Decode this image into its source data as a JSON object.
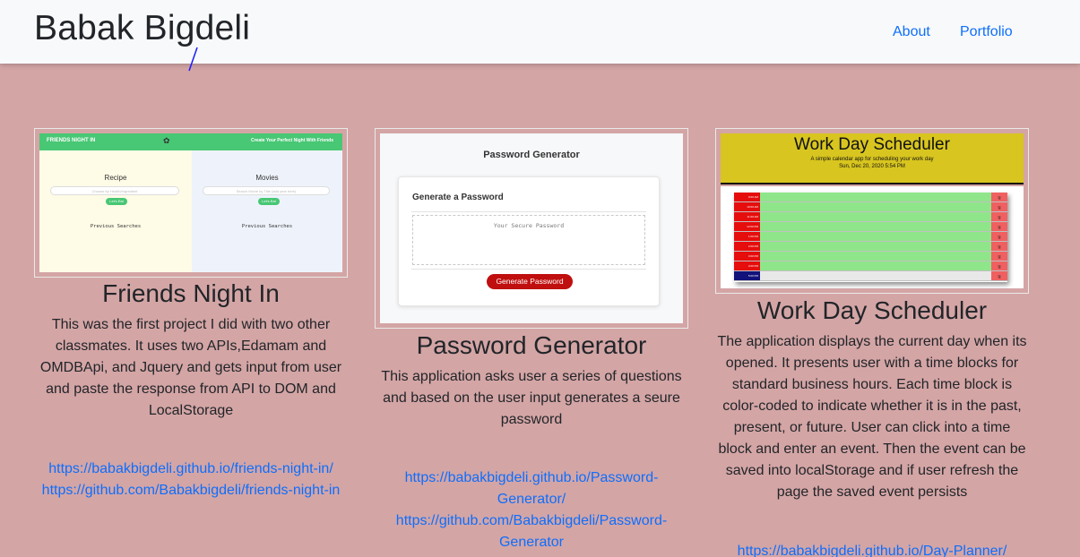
{
  "nav": {
    "brand": "Babak Bigdeli",
    "links": [
      "About",
      "Portfolio"
    ]
  },
  "projects": [
    {
      "title": "Friends Night In",
      "description": "This was the first project I did with two other classmates. It uses two APIs,Edamam and OMDBApi, and Jquery and gets input from user and paste the response from API to DOM and LocalStorage",
      "links": [
        "https://babakbigdeli.github.io/friends-night-in/",
        "https://github.com/Babakbigdeli/friends-night-in"
      ],
      "thumb": {
        "bar_left": "FRIENDS NIGHT IN",
        "bar_right": "Create Your Perfect Night With Friends",
        "left_heading": "Recipe",
        "right_heading": "Movies",
        "left_placeholder": "Choose by Health/Ingredient",
        "right_placeholder": "Search Movie by Title (add year here)",
        "button": "Let's Eat",
        "right_button": "Let's Eat",
        "previous": "Previous Searches"
      }
    },
    {
      "title": "Password Generator",
      "description": "This application asks user a series of questions and based on the user input generates a seure password",
      "links": [
        "https://babakbigdeli.github.io/Password-Generator/",
        "https://github.com/Babakbigdeli/Password-Generator"
      ],
      "thumb": {
        "heading": "Password Generator",
        "card_title": "Generate a Password",
        "placeholder": "Your Secure Password",
        "button": "Generate Password"
      }
    },
    {
      "title": "Work Day Scheduler",
      "description": "The application displays the current day when its opened. It presents user with a time blocks for standard business hours. Each time block is color-coded to indicate whether it is in the past, present, or future. User can click into a time block and enter an event. Then the event can be saved into localStorage and if user refresh the page the saved event persists",
      "links": [
        "https://babakbigdeli.github.io/Day-Planner/"
      ],
      "thumb": {
        "title": "Work Day Scheduler",
        "subtitle": "A simple calendar app for scheduling your work day",
        "date": "Sun, Dec 20, 2020 5:54 PM",
        "hours": [
          "9:00 AM",
          "10:00 AM",
          "11:00 AM",
          "12:00 PM",
          "1:00 PM",
          "2:00 PM",
          "3:00 PM",
          "4:00 PM",
          "5:00 PM"
        ]
      }
    }
  ],
  "colors": {
    "page_background": "#d4a5a5",
    "navbar_background": "#f8f9fa",
    "link": "#0d6efd"
  }
}
